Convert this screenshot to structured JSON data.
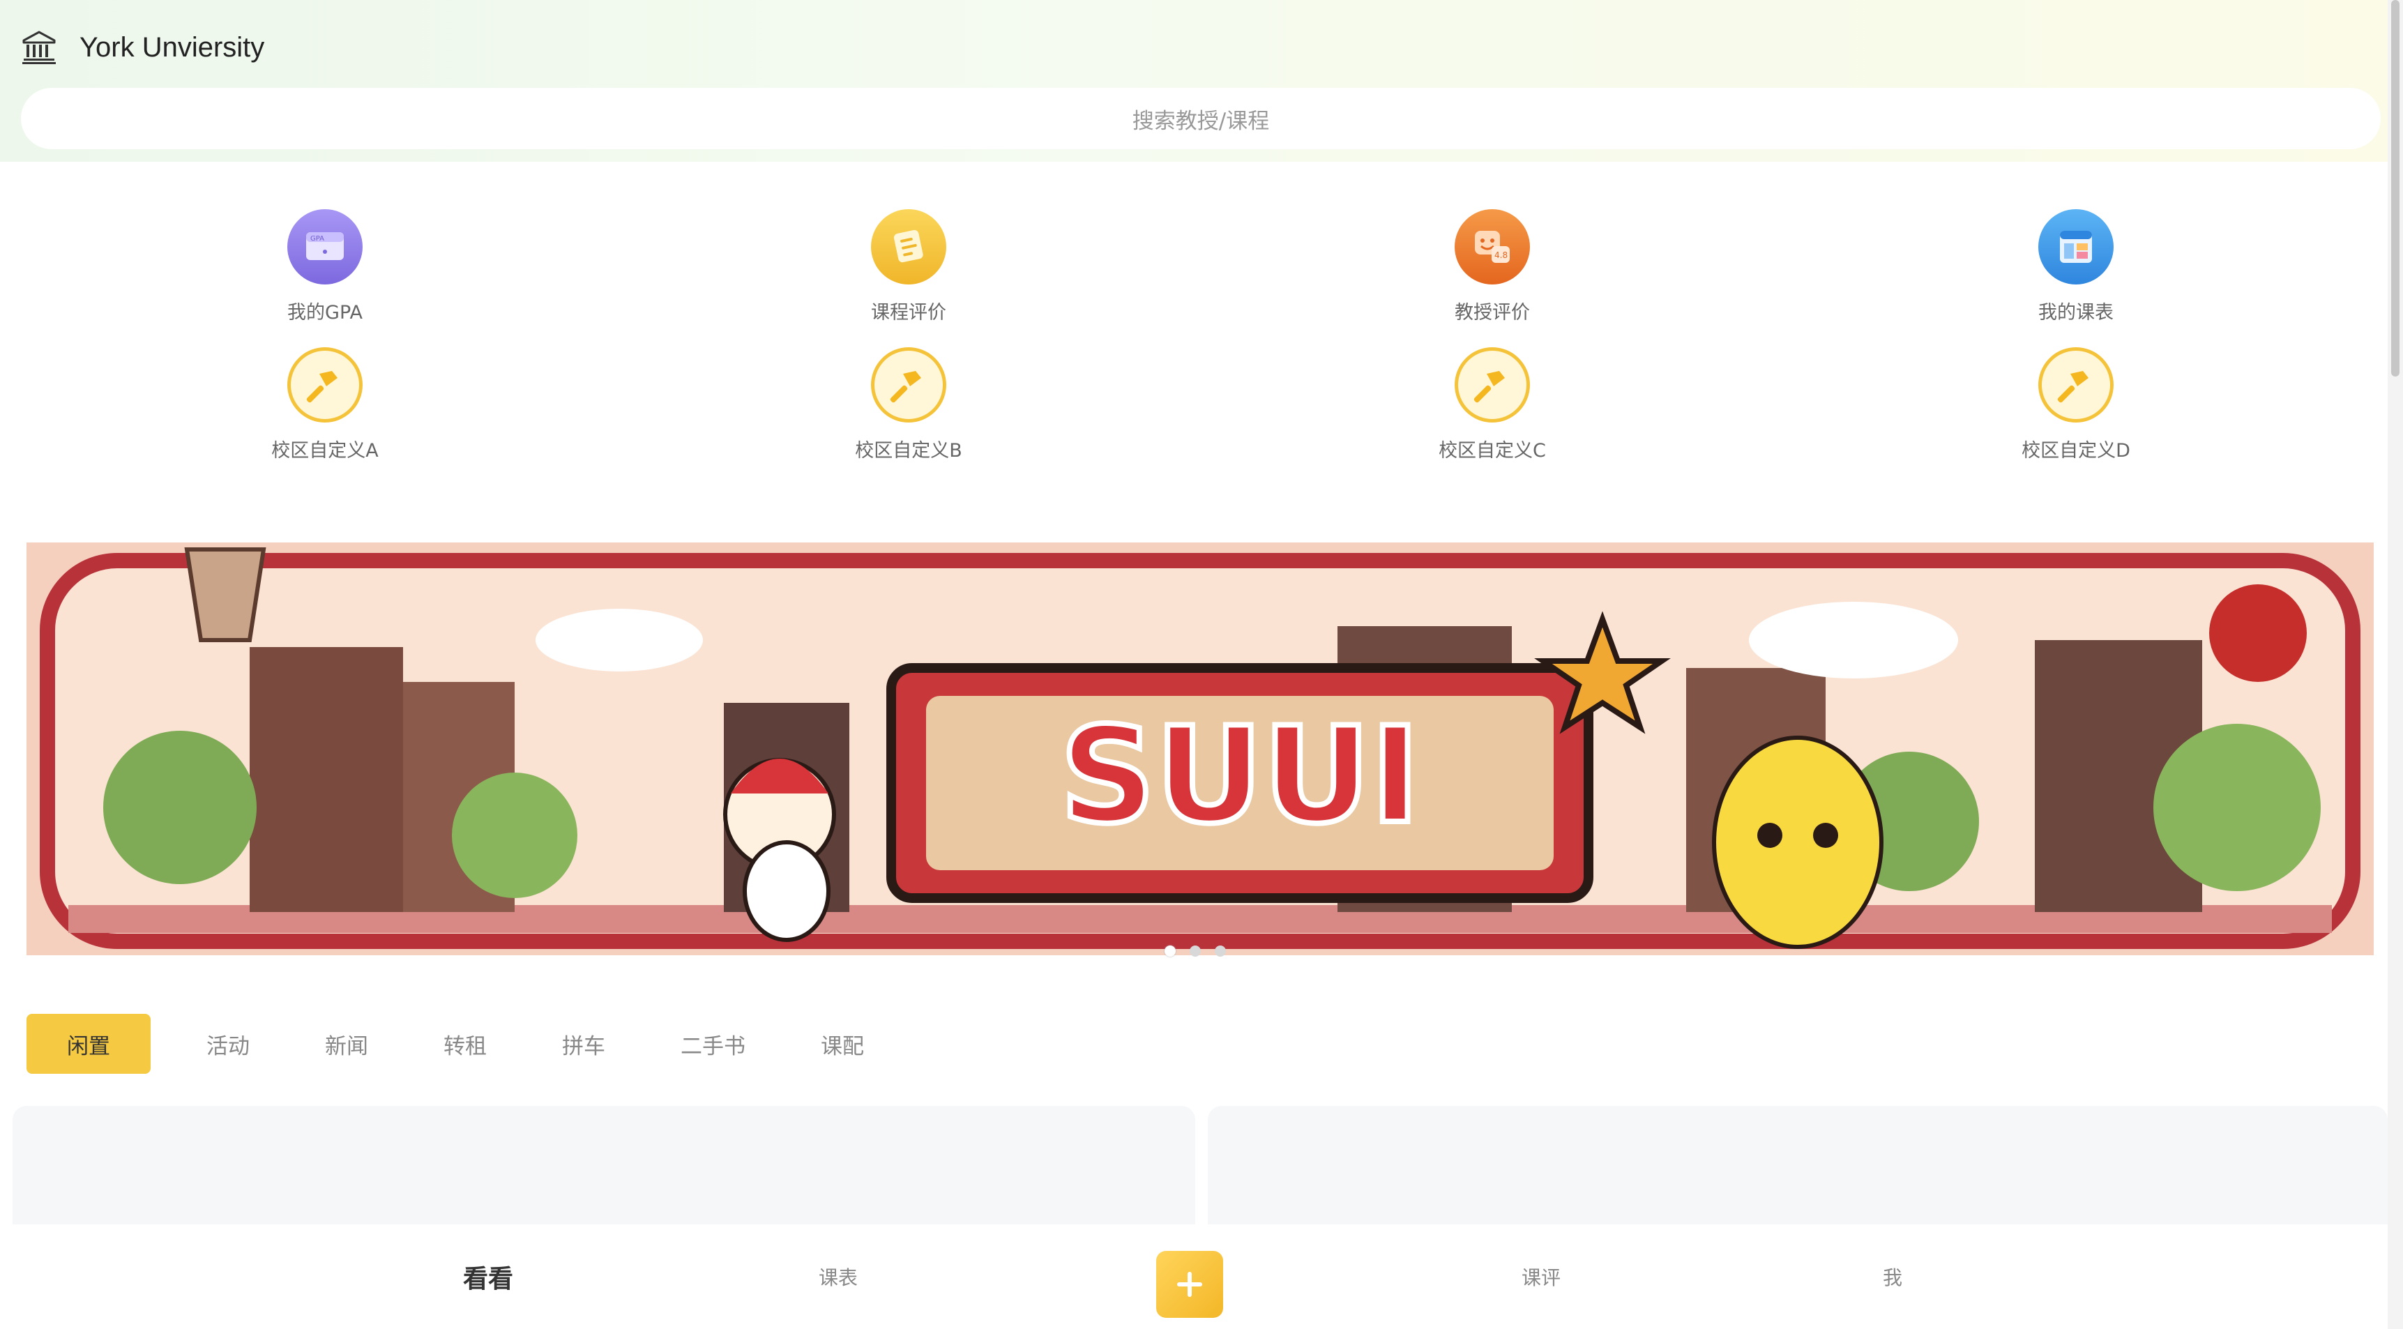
{
  "header": {
    "university_name": "York Unviersity",
    "icon": "bank-icon",
    "search_placeholder": "搜索教授/课程"
  },
  "features": [
    {
      "label": "我的GPA",
      "icon": "gpa-icon",
      "color": "#8e7be8"
    },
    {
      "label": "课程评价",
      "icon": "course-review-icon",
      "color": "#f6c33a"
    },
    {
      "label": "教授评价",
      "icon": "professor-review-icon",
      "color": "#ef7a2b"
    },
    {
      "label": "我的课表",
      "icon": "schedule-icon",
      "color": "#3f9be8"
    },
    {
      "label": "校区自定义A",
      "icon": "hammer-icon",
      "color": "#f6c33a"
    },
    {
      "label": "校区自定义B",
      "icon": "hammer-icon",
      "color": "#f6c33a"
    },
    {
      "label": "校区自定义C",
      "icon": "hammer-icon",
      "color": "#f6c33a"
    },
    {
      "label": "校区自定义D",
      "icon": "hammer-icon",
      "color": "#f6c33a"
    }
  ],
  "banner": {
    "text": "SUUI",
    "slides": 3,
    "active_slide": 1
  },
  "tabs": [
    "闲置",
    "活动",
    "新闻",
    "转租",
    "拼车",
    "二手书",
    "课配"
  ],
  "active_tab": "闲置",
  "bottom_nav": {
    "items": [
      "看看",
      "课表",
      "课评",
      "我"
    ],
    "active": "看看",
    "plus_icon": "plus-icon"
  },
  "colors": {
    "accent": "#f5c941",
    "topbar_start": "#edf7ec",
    "topbar_end": "#fbfbe7"
  }
}
